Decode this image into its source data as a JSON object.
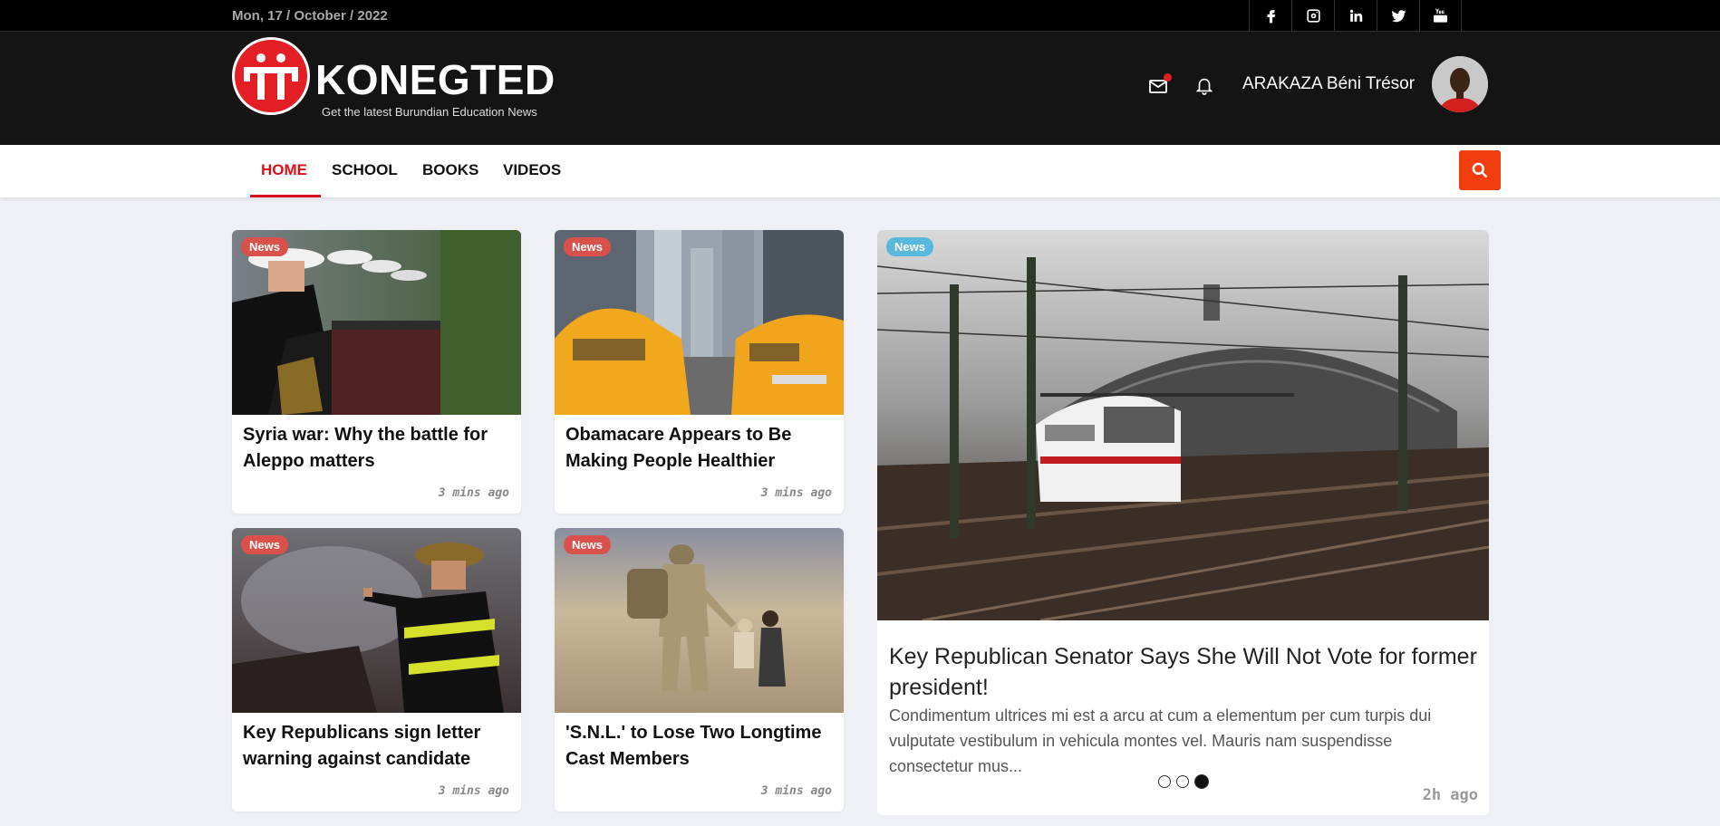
{
  "topbar": {
    "date": "Mon, 17 / October / 2022",
    "socials": [
      "facebook-icon",
      "instagram-icon",
      "linkedin-icon",
      "twitter-icon",
      "youtube-icon"
    ]
  },
  "header": {
    "brand": "KONEGTED",
    "tagline": "Get the latest Burundian Education News",
    "username": "ARAKAZA Béni Trésor",
    "accent": "#e31e24"
  },
  "nav": {
    "items": [
      "HOME",
      "SCHOOL",
      "BOOKS",
      "VIDEOS"
    ],
    "active": "HOME",
    "search_color": "#f23d0e"
  },
  "cards": [
    {
      "badge": "News",
      "title": "Syria war: Why the battle for Aleppo matters",
      "time": "3 mins ago"
    },
    {
      "badge": "News",
      "title": "Obamacare Appears to Be Making People Healthier",
      "time": "3 mins ago"
    },
    {
      "badge": "News",
      "title": "Key Republicans sign letter warning against candidate",
      "time": "3 mins ago"
    },
    {
      "badge": "News",
      "title": "'S.N.L.' to Lose Two Longtime Cast Members",
      "time": "3 mins ago"
    }
  ],
  "feature": {
    "badge": "News",
    "title": "Key Republican Senator Says She Will Not Vote for former president!",
    "excerpt": "Condimentum ultrices mi est a arcu at cum a elementum per cum turpis dui vulputate vestibulum in vehicula montes vel. Mauris nam suspendisse consectetur mus...",
    "time": "2h  ago",
    "slides_total": 3,
    "slide_active": 3
  }
}
